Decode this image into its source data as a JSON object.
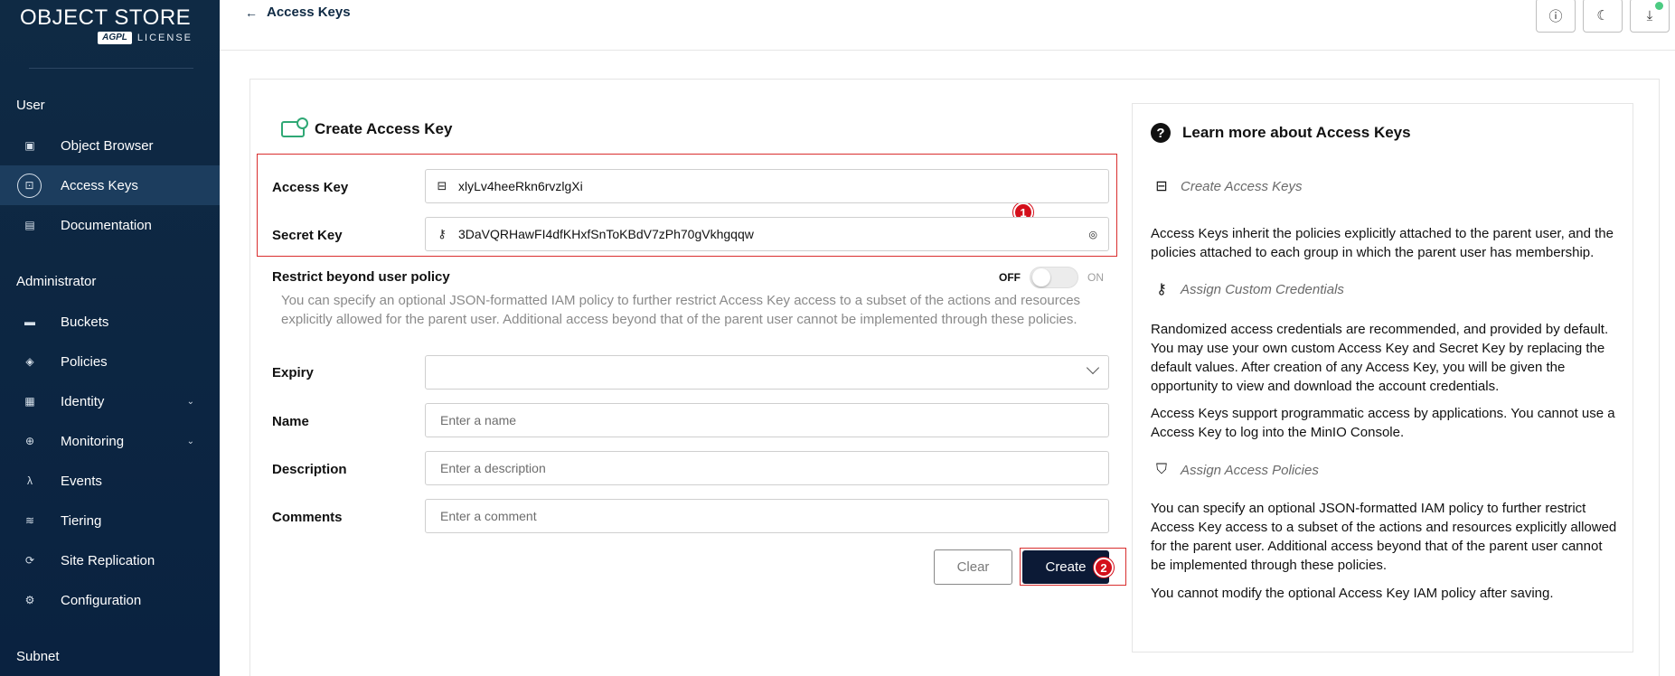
{
  "app": {
    "logo_main": "OBJECT STORE",
    "logo_badge": "AGPL",
    "logo_sub": "LICENSE"
  },
  "sidebar": {
    "user_title": "User",
    "user_items": [
      {
        "label": "Object Browser",
        "icon": "object-browser-icon"
      },
      {
        "label": "Access Keys",
        "icon": "access-keys-icon",
        "active": true
      },
      {
        "label": "Documentation",
        "icon": "documentation-icon"
      }
    ],
    "admin_title": "Administrator",
    "admin_items": [
      {
        "label": "Buckets",
        "icon": "buckets-icon"
      },
      {
        "label": "Policies",
        "icon": "policies-icon"
      },
      {
        "label": "Identity",
        "icon": "identity-icon"
      },
      {
        "label": "Monitoring",
        "icon": "monitoring-icon"
      },
      {
        "label": "Events",
        "icon": "lambda-icon"
      },
      {
        "label": "Tiering",
        "icon": "tiering-icon"
      },
      {
        "label": "Site Replication",
        "icon": "site-replication-icon"
      },
      {
        "label": "Configuration",
        "icon": "configuration-icon"
      }
    ],
    "subnet_title": "Subnet"
  },
  "topbar": {
    "back_label": "Access Keys"
  },
  "form": {
    "title": "Create Access Key",
    "access_key_label": "Access Key",
    "access_key_value": "xlyLv4heeRkn6rvzlgXi",
    "secret_key_label": "Secret Key",
    "secret_key_value": "3DaVQRHawFI4dfKHxfSnToKBdV7zPh70gVkhgqqw",
    "restrict_label": "Restrict beyond user policy",
    "toggle_off": "OFF",
    "toggle_on": "ON",
    "restrict_desc": "You can specify an optional JSON-formatted IAM policy to further restrict Access Key access to a subset of the actions and resources explicitly allowed for the parent user. Additional access beyond that of the parent user cannot be implemented through these policies.",
    "expiry_label": "Expiry",
    "name_label": "Name",
    "name_placeholder": "Enter a name",
    "description_label": "Description",
    "description_placeholder": "Enter a description",
    "comments_label": "Comments",
    "comments_placeholder": "Enter a comment",
    "clear_label": "Clear",
    "create_label": "Create",
    "badge_1": "1",
    "badge_2": "2"
  },
  "help": {
    "title": "Learn more about Access Keys",
    "sub1": "Create Access Keys",
    "p1": "Access Keys inherit the policies explicitly attached to the parent user, and the policies attached to each group in which the parent user has membership.",
    "sub2": "Assign Custom Credentials",
    "p2": "Randomized access credentials are recommended, and provided by default. You may use your own custom Access Key and Secret Key by replacing the default values. After creation of any Access Key, you will be given the opportunity to view and download the account credentials.",
    "p3": "Access Keys support programmatic access by applications. You cannot use a Access Key to log into the MinIO Console.",
    "sub3": "Assign Access Policies",
    "p4": "You can specify an optional JSON-formatted IAM policy to further restrict Access Key access to a subset of the actions and resources explicitly allowed for the parent user. Additional access beyond that of the parent user cannot be implemented through these policies.",
    "p5": "You cannot modify the optional Access Key IAM policy after saving."
  },
  "colors": {
    "sidebar_bg": "#0f2a44",
    "active_item": "#1c3d5e",
    "accent_green": "#2fa875",
    "highlight_red": "#d92e2e",
    "create_button": "#0c1a36"
  }
}
